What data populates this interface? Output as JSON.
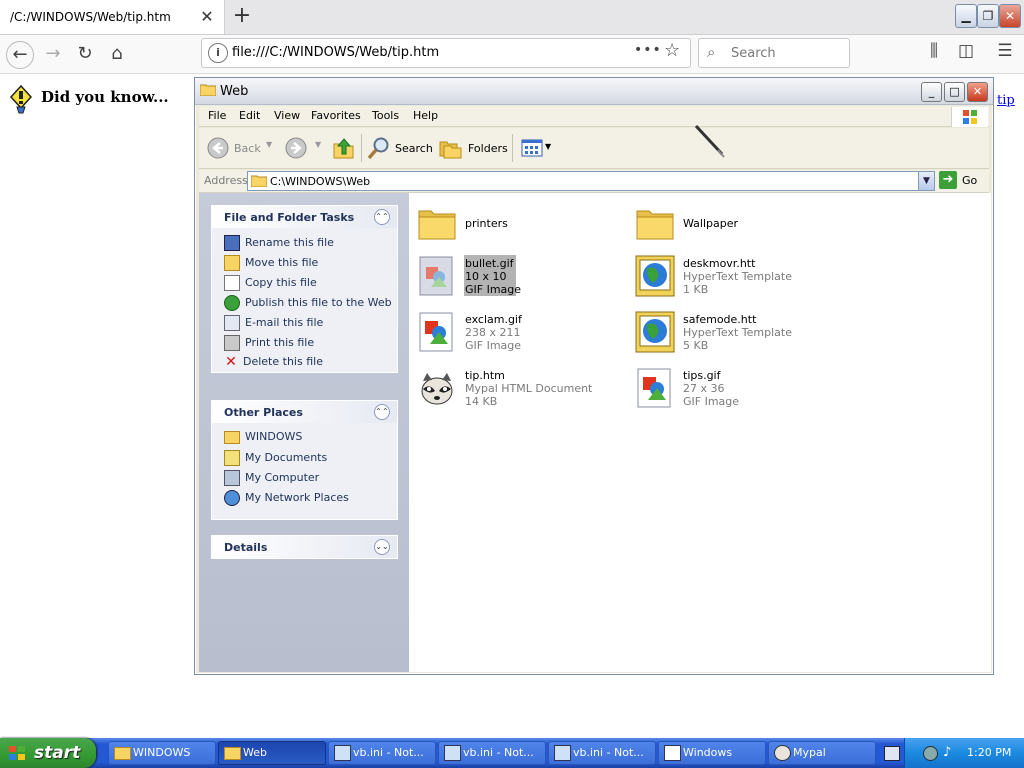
{
  "browser": {
    "tab_title": "/C:/WINDOWS/Web/tip.htm",
    "url": "file:///C:/WINDOWS/Web/tip.htm",
    "search_placeholder": "Search"
  },
  "page": {
    "heading": "Did you know...",
    "link": "tip"
  },
  "explorer": {
    "title": "Web",
    "menu": [
      "File",
      "Edit",
      "View",
      "Favorites",
      "Tools",
      "Help"
    ],
    "toolbar": {
      "back": "Back",
      "search": "Search",
      "folders": "Folders"
    },
    "address_label": "Address",
    "address": "C:\\WINDOWS\\Web",
    "go_label": "Go",
    "tasks_panel": {
      "title": "File and Folder Tasks",
      "items": [
        {
          "label": "Rename this file",
          "icon": "rename-icon"
        },
        {
          "label": "Move this file",
          "icon": "move-icon"
        },
        {
          "label": "Copy this file",
          "icon": "copy-icon"
        },
        {
          "label": "Publish this file to the Web",
          "icon": "globe-icon"
        },
        {
          "label": "E-mail this file",
          "icon": "email-icon"
        },
        {
          "label": "Print this file",
          "icon": "printer-icon"
        },
        {
          "label": "Delete this file",
          "icon": "delete-icon"
        }
      ]
    },
    "places_panel": {
      "title": "Other Places",
      "items": [
        {
          "label": "WINDOWS",
          "icon": "folder-icon"
        },
        {
          "label": "My Documents",
          "icon": "my-documents-icon"
        },
        {
          "label": "My Computer",
          "icon": "my-computer-icon"
        },
        {
          "label": "My Network Places",
          "icon": "network-icon"
        }
      ]
    },
    "details_panel": {
      "title": "Details"
    },
    "files": [
      {
        "name": "printers",
        "line2": "",
        "line3": "",
        "icon": "folder-icon"
      },
      {
        "name": "Wallpaper",
        "line2": "",
        "line3": "",
        "icon": "folder-icon"
      },
      {
        "name": "bullet.gif",
        "line2": "10 x 10",
        "line3": "GIF Image",
        "icon": "gif-image-icon",
        "selected": true
      },
      {
        "name": "deskmovr.htt",
        "line2": "HyperText Template",
        "line3": "1 KB",
        "icon": "htt-template-icon"
      },
      {
        "name": "exclam.gif",
        "line2": "238 x 211",
        "line3": "GIF Image",
        "icon": "gif-image-icon"
      },
      {
        "name": "safemode.htt",
        "line2": "HyperText Template",
        "line3": "5 KB",
        "icon": "htt-template-icon"
      },
      {
        "name": "tip.htm",
        "line2": "Mypal HTML Document",
        "line3": "14 KB",
        "icon": "raccoon-icon"
      },
      {
        "name": "tips.gif",
        "line2": "27 x 36",
        "line3": "GIF Image",
        "icon": "gif-image-icon"
      }
    ]
  },
  "taskbar": {
    "start_label": "start",
    "tasks": [
      {
        "label": "WINDOWS",
        "active": false
      },
      {
        "label": "Web",
        "active": true
      },
      {
        "label": "vb.ini - Not...",
        "active": false
      },
      {
        "label": "vb.ini - Not...",
        "active": false
      },
      {
        "label": "vb.ini - Not...",
        "active": false
      },
      {
        "label": "Windows",
        "active": false
      },
      {
        "label": "Mypal",
        "active": false
      }
    ],
    "clock": "1:20 PM"
  }
}
